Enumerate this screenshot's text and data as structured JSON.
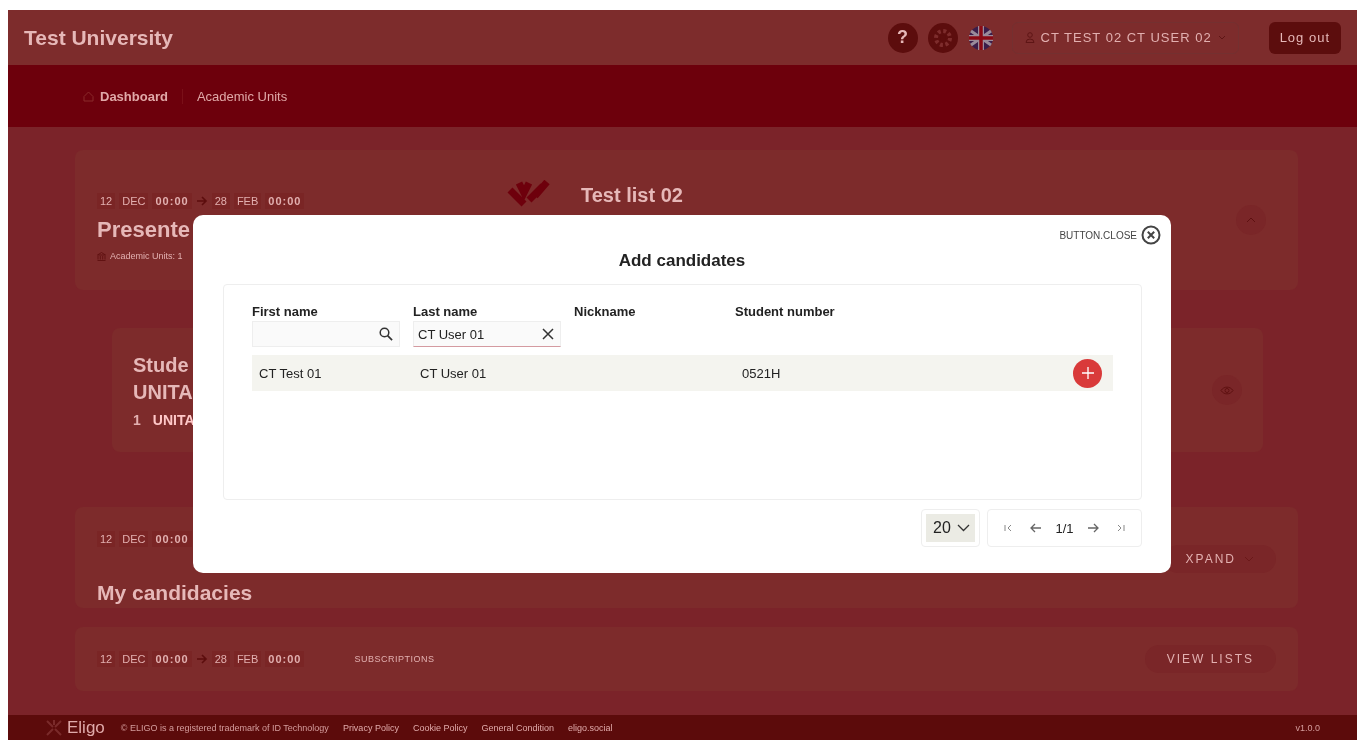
{
  "header": {
    "title": "Test University",
    "help": "?",
    "user": "CT TEST 02 CT USER 02",
    "logout": "Log out"
  },
  "breadcrumb": [
    {
      "label": "Dashboard",
      "kind": "home"
    },
    {
      "label": "Academic Units",
      "kind": "plain"
    }
  ],
  "election_card": {
    "dates": {
      "start_day": "12",
      "start_month": "DEC",
      "start_time": "00:00",
      "end_day": "28",
      "end_month": "FEB",
      "end_time": "00:00"
    },
    "title": "Presente",
    "units": "Academic Units: 1",
    "list_name": "Test list 02"
  },
  "unit_card": {
    "title_lines": [
      "Stude",
      "UNITA"
    ],
    "count": "1",
    "label": "UNITA"
  },
  "candidacies_card": {
    "dates": {
      "start_day": "12",
      "start_month": "DEC",
      "start_time": "00:00"
    },
    "title": "My candidacies",
    "expand": "XPAND"
  },
  "subscriptions_card": {
    "dates": {
      "start_day": "12",
      "start_month": "DEC",
      "start_time": "00:00",
      "end_day": "28",
      "end_month": "FEB",
      "end_time": "00:00"
    },
    "label": "SUBSCRIPTIONS",
    "button": "VIEW LISTS"
  },
  "modal": {
    "close": "BUTTON.CLOSE",
    "title": "Add candidates",
    "columns": [
      {
        "label": "First name",
        "kind": "search"
      },
      {
        "label": "Last name",
        "kind": "clear",
        "value": "CT User 01"
      },
      {
        "label": "Nickname",
        "kind": "plain"
      },
      {
        "label": "Student number",
        "kind": "plain"
      }
    ],
    "rows": [
      {
        "cells": [
          "CT Test 01",
          "CT User 01",
          "",
          "0521H"
        ]
      }
    ],
    "page_size": "20",
    "page": "1/1"
  },
  "footer": {
    "brand": "Eligo",
    "copyright": "© ELIGO is a registered trademark of ID Technology",
    "links": [
      "Privacy Policy",
      "Cookie Policy",
      "General Condition",
      "eligo.social"
    ],
    "version": "v1.0.0"
  }
}
